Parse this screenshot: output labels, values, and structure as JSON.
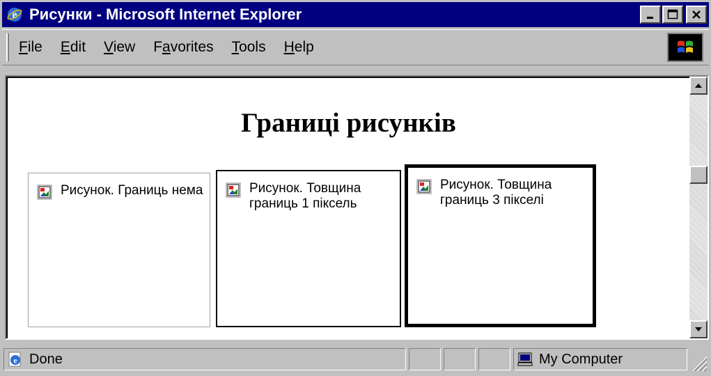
{
  "window": {
    "title": "Рисунки - Microsoft Internet Explorer"
  },
  "menu": {
    "items": [
      {
        "label_u": "F",
        "label_rest": "ile"
      },
      {
        "label_u": "E",
        "label_rest": "dit"
      },
      {
        "label_u": "V",
        "label_rest": "iew"
      },
      {
        "label_pre": "F",
        "label_u": "a",
        "label_rest": "vorites"
      },
      {
        "label_u": "T",
        "label_rest": "ools"
      },
      {
        "label_u": "H",
        "label_rest": "elp"
      }
    ]
  },
  "page": {
    "heading": "Границі рисунків",
    "images": [
      {
        "alt": "Рисунок. Границь нема",
        "border": "none"
      },
      {
        "alt": "Рисунок. Товщина границь 1 піксель",
        "border": "1px"
      },
      {
        "alt": "Рисунок. Товщина границь 3 пікселі",
        "border": "3px"
      }
    ]
  },
  "status": {
    "text": "Done",
    "zone": "My Computer"
  },
  "colors": {
    "titlebar": "#000080",
    "chrome": "#c0c0c0",
    "page_bg": "#ffffff"
  },
  "icons": {
    "app": "ie-icon",
    "throbber": "windows-logo-icon",
    "broken_image": "broken-image-icon",
    "zone": "computer-icon"
  }
}
